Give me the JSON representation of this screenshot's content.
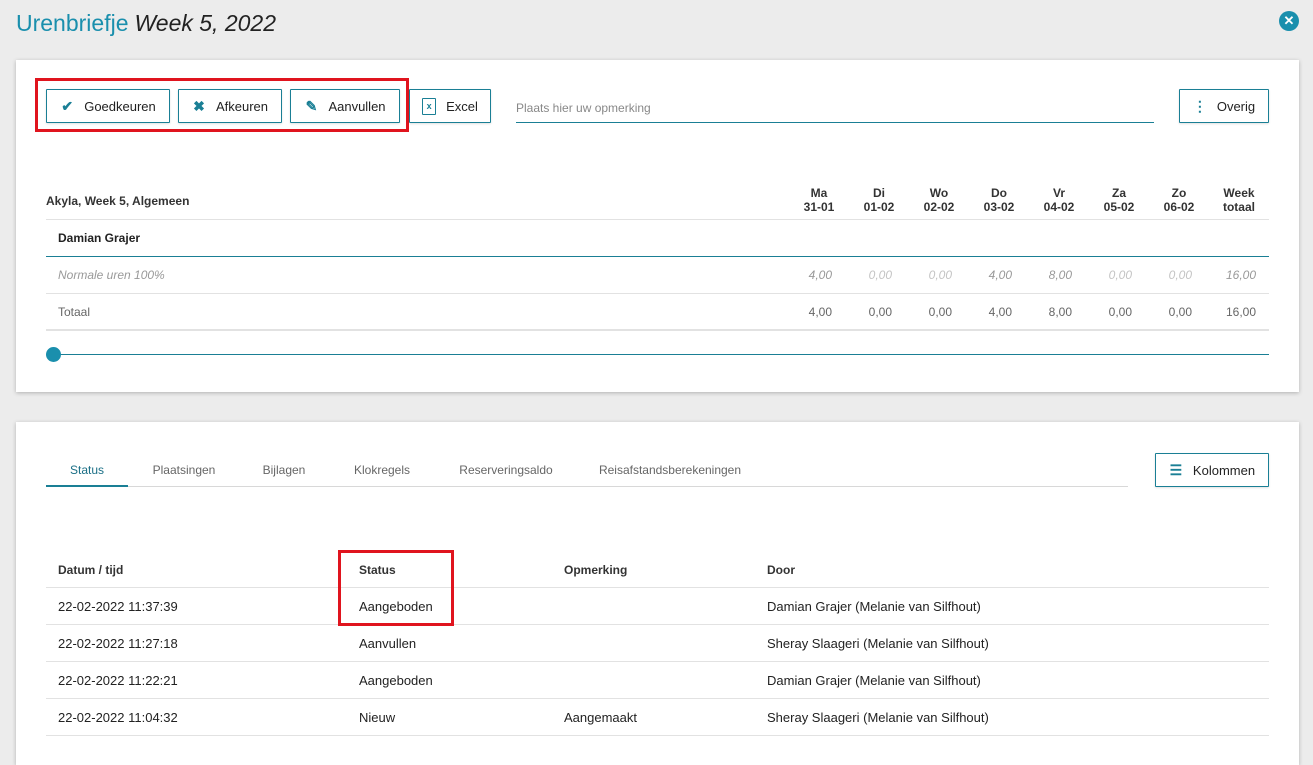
{
  "header": {
    "app_title": "Urenbriefje",
    "week_title": "Week 5, 2022",
    "close_icon": "close-icon"
  },
  "toolbar": {
    "goedkeuren": "Goedkeuren",
    "afkeuren": "Afkeuren",
    "aanvullen": "Aanvullen",
    "excel": "Excel",
    "comment_placeholder": "Plaats hier uw opmerking",
    "overig": "Overig"
  },
  "hours": {
    "group_label": "Akyla, Week 5, Algemeen",
    "days": [
      {
        "name": "Ma",
        "date": "31-01"
      },
      {
        "name": "Di",
        "date": "01-02"
      },
      {
        "name": "Wo",
        "date": "02-02"
      },
      {
        "name": "Do",
        "date": "03-02"
      },
      {
        "name": "Vr",
        "date": "04-02"
      },
      {
        "name": "Za",
        "date": "05-02"
      },
      {
        "name": "Zo",
        "date": "06-02"
      },
      {
        "name": "Week",
        "date": "totaal"
      }
    ],
    "employee": "Damian Grajer",
    "rows": [
      {
        "label": "Normale uren 100%",
        "values": [
          "4,00",
          "0,00",
          "0,00",
          "4,00",
          "8,00",
          "0,00",
          "0,00",
          "16,00"
        ]
      },
      {
        "label": "Totaal",
        "values": [
          "4,00",
          "0,00",
          "0,00",
          "4,00",
          "8,00",
          "0,00",
          "0,00",
          "16,00"
        ]
      }
    ],
    "slider_position": 0
  },
  "tabs": [
    "Status",
    "Plaatsingen",
    "Bijlagen",
    "Klokregels",
    "Reserveringsaldo",
    "Reisafstandsberekeningen"
  ],
  "kolommen": "Kolommen",
  "status_table": {
    "headers": [
      "Datum / tijd",
      "Status",
      "Opmerking",
      "Door"
    ],
    "rows": [
      [
        "22-02-2022 11:37:39",
        "Aangeboden",
        "",
        "Damian Grajer (Melanie van Silfhout)"
      ],
      [
        "22-02-2022 11:27:18",
        "Aanvullen",
        "",
        "Sheray Slaageri (Melanie van Silfhout)"
      ],
      [
        "22-02-2022 11:22:21",
        "Aangeboden",
        "",
        "Damian Grajer (Melanie van Silfhout)"
      ],
      [
        "22-02-2022 11:04:32",
        "Nieuw",
        "Aangemaakt",
        "Sheray Slaageri (Melanie van Silfhout)"
      ]
    ]
  },
  "colors": {
    "accent": "#1a8fad",
    "highlight": "#e0141e"
  }
}
